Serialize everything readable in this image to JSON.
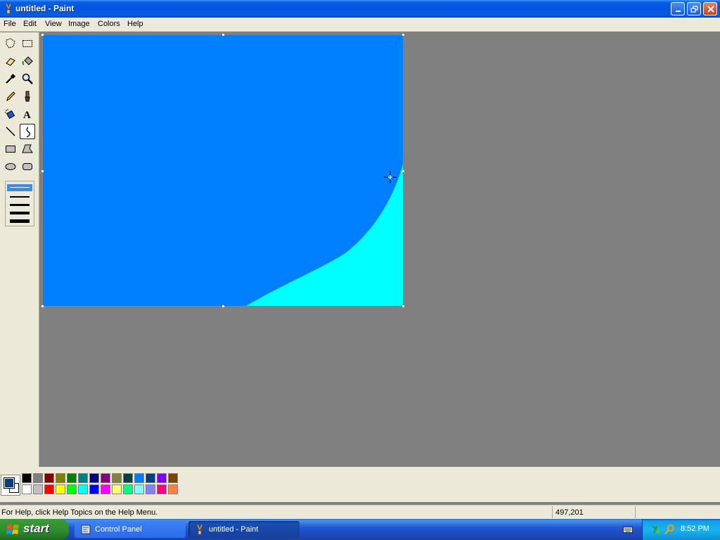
{
  "window": {
    "title": "untitled - Paint",
    "app_icon": "paint-brush-icon"
  },
  "menu": [
    "File",
    "Edit",
    "View",
    "Image",
    "Colors",
    "Help"
  ],
  "tools": [
    {
      "name": "free-form-select-icon"
    },
    {
      "name": "select-icon"
    },
    {
      "name": "eraser-icon"
    },
    {
      "name": "fill-with-color-icon"
    },
    {
      "name": "pick-color-icon"
    },
    {
      "name": "magnifier-icon"
    },
    {
      "name": "pencil-icon"
    },
    {
      "name": "brush-icon"
    },
    {
      "name": "airbrush-icon"
    },
    {
      "name": "text-icon",
      "glyph": "A"
    },
    {
      "name": "line-icon"
    },
    {
      "name": "curve-icon",
      "selected": true
    },
    {
      "name": "rectangle-icon"
    },
    {
      "name": "polygon-icon"
    },
    {
      "name": "ellipse-icon"
    },
    {
      "name": "rounded-rectangle-icon"
    }
  ],
  "canvas": {
    "background_color": "#0080ff",
    "fill_color": "#00ffff",
    "cursor": "crosshair-icon"
  },
  "palette": {
    "foreground": "#003f7f",
    "background": "#ffffff",
    "top_row": [
      "#000000",
      "#808080",
      "#800000",
      "#808000",
      "#008000",
      "#008080",
      "#000080",
      "#800080",
      "#808040",
      "#004040",
      "#0080ff",
      "#004080",
      "#8000ff",
      "#804000"
    ],
    "bottom_row": [
      "#ffffff",
      "#c0c0c0",
      "#ff0000",
      "#ffff00",
      "#00ff00",
      "#00ffff",
      "#0000ff",
      "#ff00ff",
      "#ffff80",
      "#00ff80",
      "#80ffff",
      "#8080ff",
      "#ff0080",
      "#ff8040"
    ]
  },
  "status": {
    "help_text": "For Help, click Help Topics on the Help Menu.",
    "coordinates": "497,201"
  },
  "taskbar": {
    "start_label": "start",
    "tasks": [
      {
        "label": "Control Panel",
        "active": false
      },
      {
        "label": "untitled - Paint",
        "active": true
      }
    ],
    "clock": "8:52 PM"
  }
}
